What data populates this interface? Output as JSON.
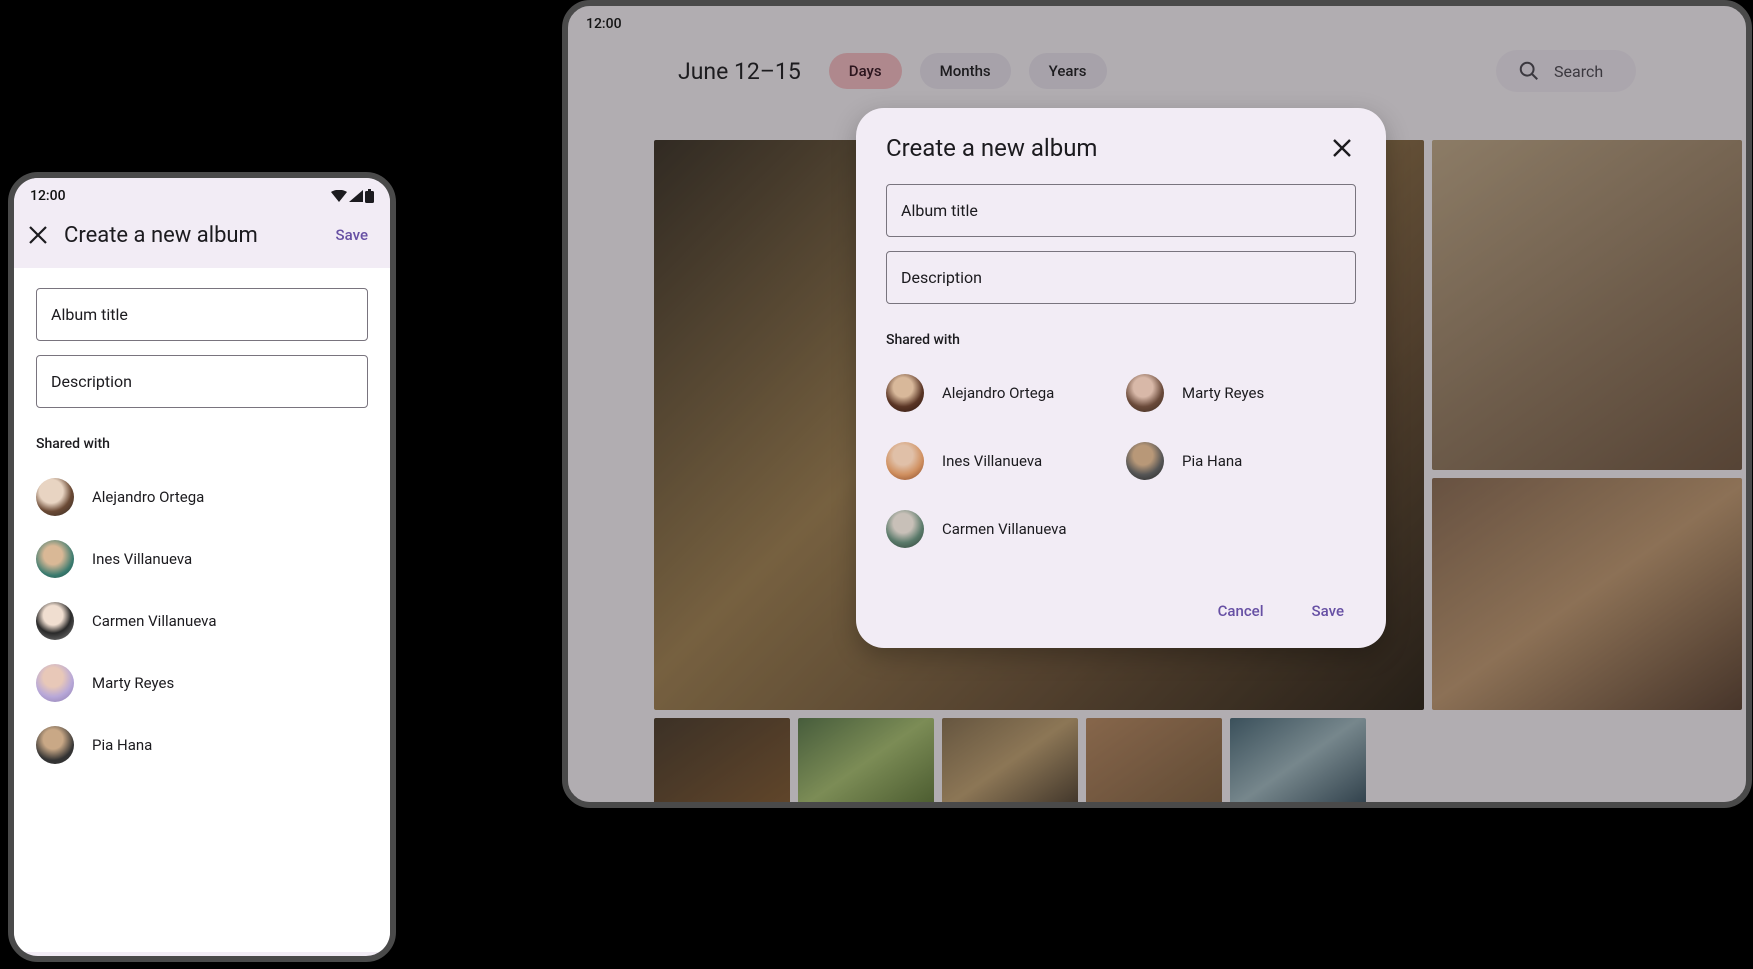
{
  "phone": {
    "status_time": "12:00",
    "title": "Create a new album",
    "save_label": "Save",
    "album_title_placeholder": "Album title",
    "description_placeholder": "Description",
    "shared_with_label": "Shared with",
    "people": [
      {
        "name": "Alejandro Ortega"
      },
      {
        "name": "Ines Villanueva"
      },
      {
        "name": "Carmen Villanueva"
      },
      {
        "name": "Marty Reyes"
      },
      {
        "name": "Pia Hana"
      }
    ]
  },
  "tablet": {
    "status_time": "12:00",
    "date_range": "June 12–15",
    "filters": [
      {
        "label": "Days",
        "active": true
      },
      {
        "label": "Months",
        "active": false
      },
      {
        "label": "Years",
        "active": false
      }
    ],
    "search_placeholder": "Search"
  },
  "dialog": {
    "title": "Create a new album",
    "album_title_placeholder": "Album title",
    "description_placeholder": "Description",
    "shared_with_label": "Shared with",
    "people_col1": [
      {
        "name": "Alejandro Ortega"
      },
      {
        "name": "Ines Villanueva"
      },
      {
        "name": "Carmen Villanueva"
      }
    ],
    "people_col2": [
      {
        "name": "Marty Reyes"
      },
      {
        "name": "Pia Hana"
      }
    ],
    "cancel_label": "Cancel",
    "save_label": "Save"
  }
}
